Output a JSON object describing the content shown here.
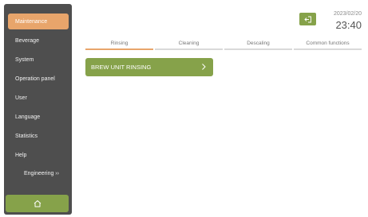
{
  "sidebar": {
    "items": [
      {
        "label": "Maintenance",
        "active": true
      },
      {
        "label": "Beverage"
      },
      {
        "label": "System"
      },
      {
        "label": "Operation panel"
      },
      {
        "label": "User"
      },
      {
        "label": "Language"
      },
      {
        "label": "Statistics"
      },
      {
        "label": "Help"
      },
      {
        "label": "Engineering ››"
      }
    ],
    "home_icon": "home-icon"
  },
  "header": {
    "logout_icon": "logout-icon",
    "date": "2023/02/20",
    "time": "23:40"
  },
  "tabs": [
    {
      "label": "Rinsing",
      "active": true
    },
    {
      "label": "Cleaning"
    },
    {
      "label": "Descaling"
    },
    {
      "label": "Common functions"
    }
  ],
  "actions": [
    {
      "label": "BREW UNIT RINSING",
      "icon": "chevron-right-icon"
    }
  ],
  "colors": {
    "sidebar": "#4e4e4e",
    "accent_orange": "#e8a56b",
    "accent_green": "#86a24a"
  }
}
